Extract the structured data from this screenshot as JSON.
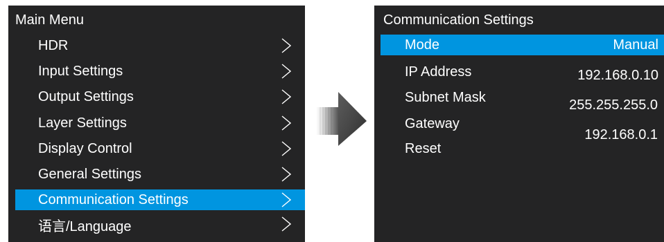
{
  "main_menu": {
    "title": "Main Menu",
    "items": [
      {
        "label": "HDR"
      },
      {
        "label": "Input Settings"
      },
      {
        "label": "Output Settings"
      },
      {
        "label": "Layer Settings"
      },
      {
        "label": "Display Control"
      },
      {
        "label": "General Settings"
      },
      {
        "label": "Communication Settings",
        "selected": true
      },
      {
        "label": "语言/Language"
      }
    ]
  },
  "navigation_arrow": {
    "icon": "right-arrow-icon",
    "color": "#4a4a4a"
  },
  "communication_settings": {
    "title": "Communication Settings",
    "rows": [
      {
        "label": "Mode",
        "value": "Manual",
        "selected": true
      },
      {
        "label": "IP Address",
        "value": "192.168.0.10"
      },
      {
        "label": "Subnet Mask",
        "value": "255.255.255.0"
      },
      {
        "label": "Gateway",
        "value": "192.168.0.1"
      },
      {
        "label": "Reset",
        "value": ""
      }
    ]
  },
  "colors": {
    "panel_background": "#242425",
    "selection_highlight": "#0095e0",
    "text": "#ffffff"
  }
}
